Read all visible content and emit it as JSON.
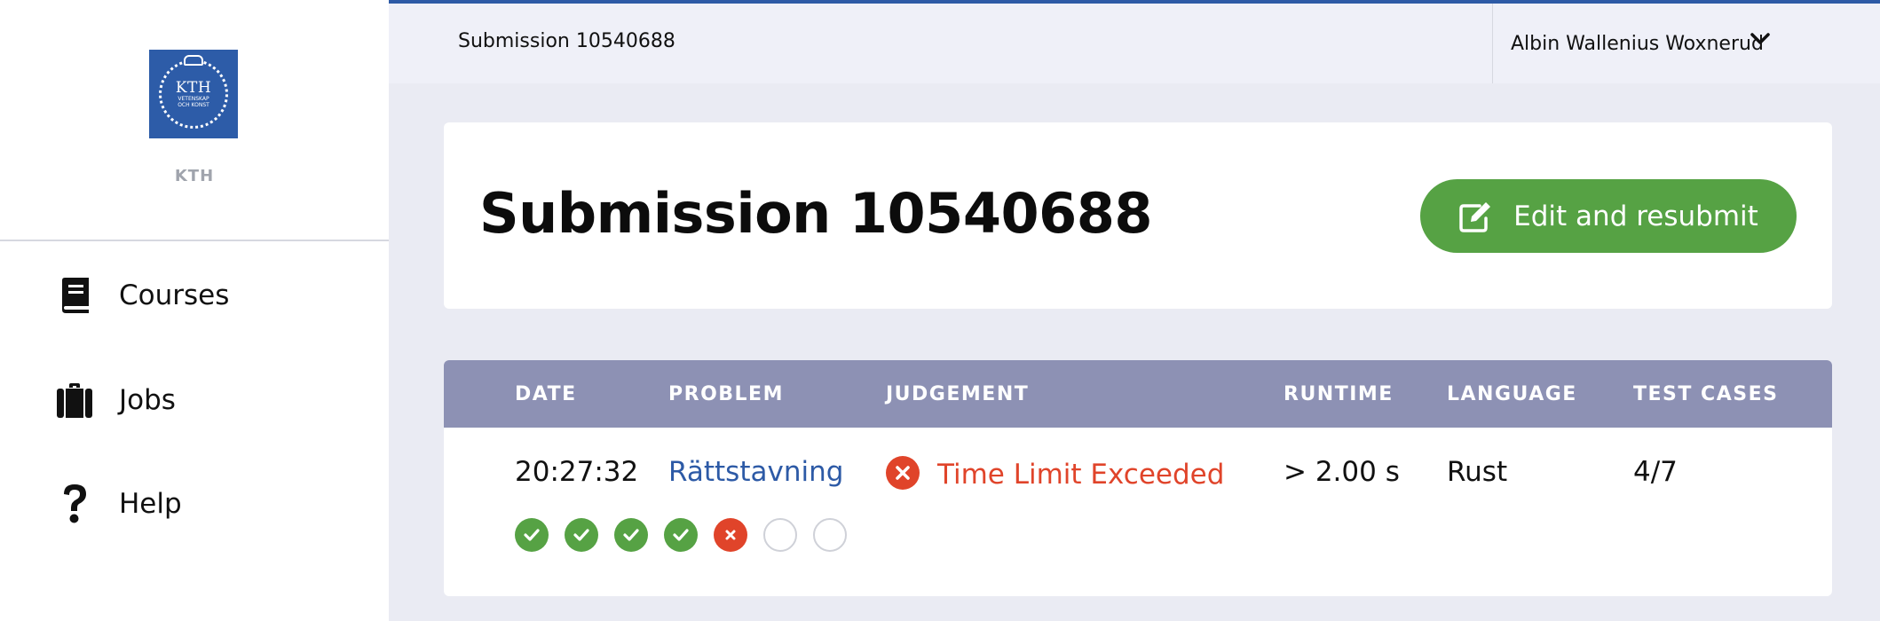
{
  "sidebar": {
    "org_logo_text": "KTH",
    "org_logo_sub1": "VETENSKAP",
    "org_logo_sub2": "OCH KONST",
    "org_name": "KTH",
    "items": [
      {
        "label": "Courses",
        "icon": "book-icon"
      },
      {
        "label": "Jobs",
        "icon": "briefcase-icon"
      },
      {
        "label": "Help",
        "icon": "question-icon"
      }
    ]
  },
  "topbar": {
    "title": "Submission 10540688",
    "user_name": "Albin Wallenius Woxnerud",
    "accent_color": "#2d5aa6"
  },
  "header": {
    "title": "Submission 10540688",
    "resubmit_label": "Edit and resubmit",
    "resubmit_color": "#56a244"
  },
  "table": {
    "headers": {
      "date": "DATE",
      "problem": "PROBLEM",
      "judgement": "JUDGEMENT",
      "runtime": "RUNTIME",
      "language": "LANGUAGE",
      "test_cases": "TEST CASES"
    },
    "row": {
      "date": "20:27:32",
      "problem": "Rättstavning",
      "judgement": "Time Limit Exceeded",
      "runtime": "> 2.00 s",
      "language": "Rust",
      "test_cases": "4/7"
    },
    "test_results": [
      "pass",
      "pass",
      "pass",
      "pass",
      "fail",
      "none",
      "none"
    ],
    "status_colors": {
      "pass": "#56a244",
      "fail": "#e0442a"
    }
  }
}
